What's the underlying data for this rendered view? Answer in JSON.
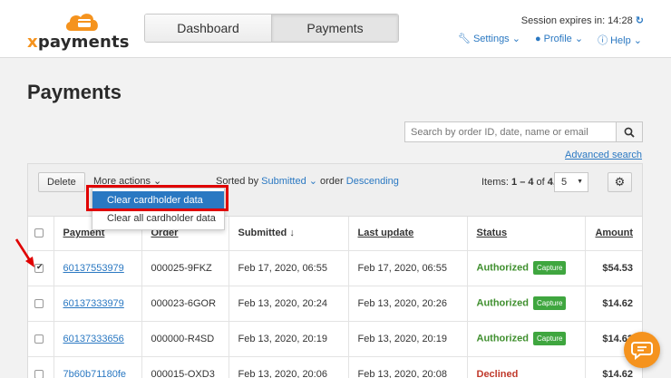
{
  "header": {
    "brand": "xpayments",
    "tabs": [
      {
        "label": "Dashboard",
        "active": false
      },
      {
        "label": "Payments",
        "active": true
      }
    ],
    "session_text": "Session expires in: 14:28",
    "nav": {
      "settings": "Settings",
      "profile": "Profile",
      "help": "Help"
    }
  },
  "page": {
    "title": "Payments"
  },
  "search": {
    "placeholder": "Search by order ID, date, name or email",
    "advanced_label": "Advanced search"
  },
  "toolbar": {
    "delete_label": "Delete",
    "more_actions_label": "More actions",
    "sorted_by_label": "Sorted by",
    "sorted_by_value": "Submitted",
    "order_label": "order",
    "order_value": "Descending",
    "items_prefix": "Items:",
    "items_range": "1 – 4",
    "items_of": "of",
    "items_total": "4,",
    "per_page": "5"
  },
  "dropdown": {
    "items": [
      "Clear cardholder data",
      "Clear all cardholder data"
    ]
  },
  "table": {
    "columns": [
      "Payment",
      "Order",
      "Submitted",
      "Last update",
      "Status",
      "Amount"
    ],
    "sort_indicator": "↓",
    "rows": [
      {
        "checked": true,
        "payment": "60137553979",
        "order": "000025-9FKZ",
        "submitted": "Feb 17, 2020, 06:55",
        "updated": "Feb 17, 2020, 06:55",
        "status": "Authorized",
        "action": "Capture",
        "amount": "$54.53"
      },
      {
        "checked": false,
        "payment": "60137333979",
        "order": "000023-6GOR",
        "submitted": "Feb 13, 2020, 20:24",
        "updated": "Feb 13, 2020, 20:26",
        "status": "Authorized",
        "action": "Capture",
        "amount": "$14.62"
      },
      {
        "checked": false,
        "payment": "60137333656",
        "order": "000000-R4SD",
        "submitted": "Feb 13, 2020, 20:19",
        "updated": "Feb 13, 2020, 20:19",
        "status": "Authorized",
        "action": "Capture",
        "amount": "$14.62"
      },
      {
        "checked": false,
        "payment": "7b60b71180fe",
        "order": "000015-OXD3",
        "submitted": "Feb 13, 2020, 20:06",
        "updated": "Feb 13, 2020, 20:08",
        "status": "Declined",
        "action": "",
        "amount": "$14.62"
      }
    ]
  },
  "colors": {
    "accent": "#2a78c2",
    "brand": "#f5931e",
    "authorized": "#3f8f2e",
    "declined": "#c0392b",
    "capture_badge": "#3fa63f",
    "highlight_box": "#e00000"
  },
  "icons": {
    "refresh": "refresh-icon",
    "settings": "wrench-icon",
    "profile": "user-icon",
    "help": "help-icon",
    "search": "search-icon",
    "gear": "gear-icon",
    "chat": "chat-icon"
  }
}
